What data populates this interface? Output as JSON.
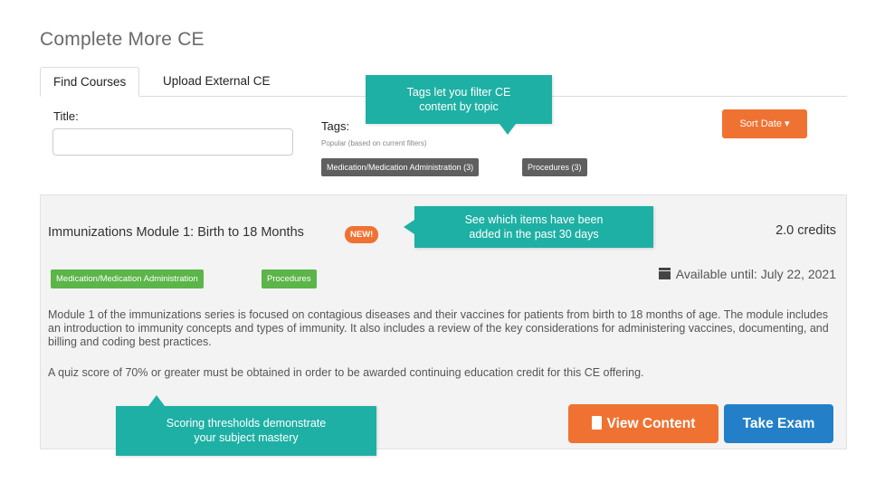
{
  "page": {
    "title": "Complete More CE"
  },
  "tabs": [
    {
      "label": "Find Courses",
      "active": true
    },
    {
      "label": "Upload External CE",
      "active": false
    }
  ],
  "filters": {
    "title_label": "Title:",
    "title_value": "",
    "tags_label": "Tags:",
    "tags_hint": "Popular (based on current filters)",
    "tags": [
      "Medication/Medication Administration (3)",
      "Procedures (3)"
    ],
    "sort_label": "Sort Date ▾"
  },
  "tooltips": {
    "tags": [
      "Tags let you filter CE",
      "content by topic"
    ],
    "new": [
      "See which items have been",
      "added in the past 30 days"
    ],
    "score": [
      "Scoring thresholds demonstrate",
      "your subject mastery"
    ]
  },
  "course": {
    "title": "Immunizations Module 1: Birth to 18 Months",
    "badge": "NEW!",
    "credits": "2.0 credits",
    "categories": [
      "Medication/Medication Administration",
      "Procedures"
    ],
    "available": "Available until: July 22, 2021",
    "description": "Module 1 of the immunizations series is focused on contagious diseases and their vaccines for patients from birth to 18 months of age. The module includes an introduction to immunity concepts and types of immunity. It also includes a review of the key considerations for administering vaccines, documenting, and billing and coding best practices.",
    "quiz_note": "A quiz score of 70% or greater must be obtained in order to be awarded continuing education credit for this CE offering.",
    "view_label": "View Content",
    "exam_label": "Take Exam"
  },
  "colors": {
    "accent_orange": "#f07232",
    "teal_tooltip": "#1eb0a4",
    "category_green": "#5bb548",
    "tag_gray": "#5f5f5f",
    "primary_blue": "#2380c8"
  },
  "icons": {
    "calendar": "calendar-icon",
    "document": "document-icon"
  }
}
